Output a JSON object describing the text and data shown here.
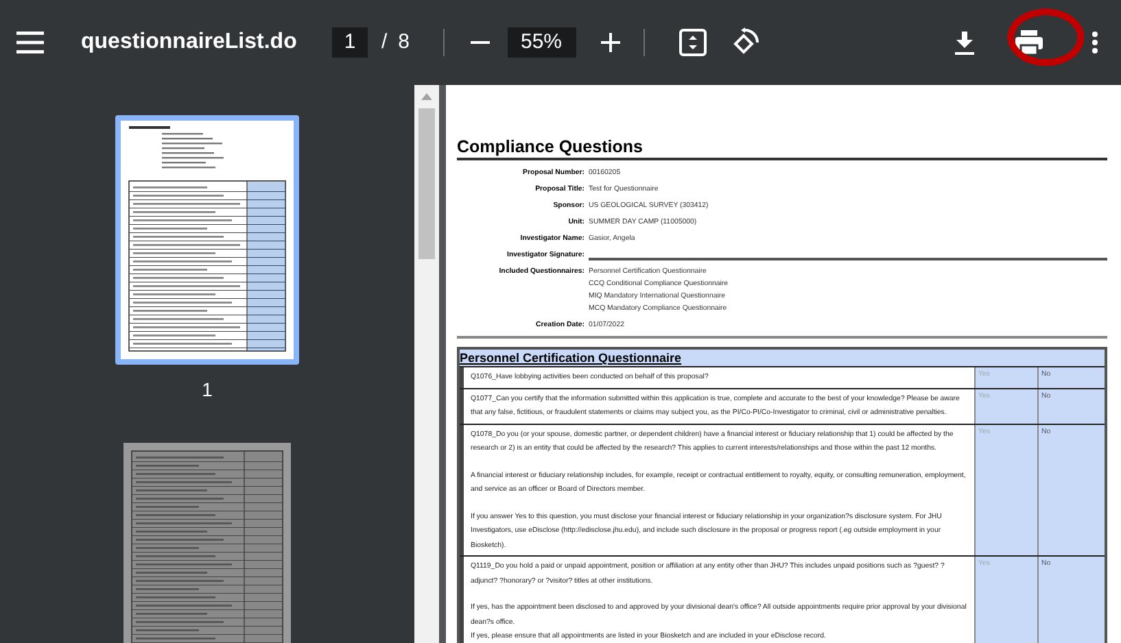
{
  "toolbar": {
    "title": "questionnaireList.do",
    "page_number": "1",
    "page_separator": "/",
    "page_count": "8",
    "zoom": "55%"
  },
  "thumbnails": [
    {
      "label": "1",
      "selected": true
    },
    {
      "selected": false
    }
  ],
  "document": {
    "heading": "Compliance Questions",
    "fields": [
      {
        "kind": "text",
        "label": "Proposal Number:",
        "values": [
          "00160205"
        ]
      },
      {
        "kind": "text",
        "label": "Proposal Title:",
        "values": [
          "Test for Questionnaire"
        ]
      },
      {
        "kind": "text",
        "label": "Sponsor:",
        "values": [
          "US GEOLOGICAL SURVEY (303412)"
        ]
      },
      {
        "kind": "text",
        "label": "Unit:",
        "values": [
          "SUMMER DAY CAMP (11005000)"
        ]
      },
      {
        "kind": "text",
        "label": "Investigator Name:",
        "values": [
          "Gasior, Angela"
        ]
      },
      {
        "kind": "signature",
        "label": "Investigator Signature:"
      },
      {
        "kind": "text",
        "label": "Included Questionnaires:",
        "values": [
          "Personnel Certification Questionnaire",
          "CCQ Conditional Compliance Questionnaire",
          "MIQ Mandatory International Questionnaire",
          "MCQ Mandatory Compliance Questionnaire"
        ]
      },
      {
        "kind": "text",
        "label": "Creation Date:",
        "values": [
          "01/07/2022"
        ]
      }
    ],
    "questionnaire": {
      "title": "Personnel Certification Questionnaire",
      "questions": [
        {
          "paragraphs": [
            "Q1076_Have lobbying activities been conducted on behalf of this proposal?"
          ],
          "yes": "Yes",
          "no": "No"
        },
        {
          "paragraphs": [
            "Q1077_Can you certify that the information submitted within this application is true, complete and accurate to the best of your knowledge? Please be aware that any false, fictitious, or fraudulent statements or claims may subject you, as the PI/Co-PI/Co-Investigator to criminal, civil or administrative penalties."
          ],
          "yes": "Yes",
          "no": "No"
        },
        {
          "paragraphs": [
            "Q1078_Do you (or your spouse, domestic partner, or dependent children) have a financial interest or fiduciary relationship that 1) could be affected by the research or 2) is an entity that could be affected by the research?  This applies to current interests/relationships and those within the past 12 months.",
            "A financial interest or fiduciary relationship includes, for example, receipt or contractual entitlement to royalty, equity, or consulting remuneration, employment, and service as an officer or Board of Directors member.",
            "If you answer Yes to this question, you must disclose your financial interest or fiduciary relationship in your organization?s disclosure system. For JHU Investigators, use eDisclose (http://edisclose.jhu.edu), and include such disclosure in the proposal or progress report (.eg outside employment in your Biosketch)."
          ],
          "yes": "Yes",
          "no": "No"
        },
        {
          "paragraphs": [
            "Q1119_Do you hold a paid or unpaid appointment, position or affiliation at any entity other than JHU?  This includes unpaid positions such as ?guest? ?adjunct? ?honorary? or ?visitor? titles at other institutions.",
            "If yes, has the appointment been disclosed to and approved by your divisional dean's office? All outside appointments require prior approval by your divisional dean?s office.\nIf yes, please ensure that all appointments are listed in your Biosketch and are included in your eDisclose record."
          ],
          "yes": "Yes",
          "no": "No"
        }
      ]
    }
  }
}
